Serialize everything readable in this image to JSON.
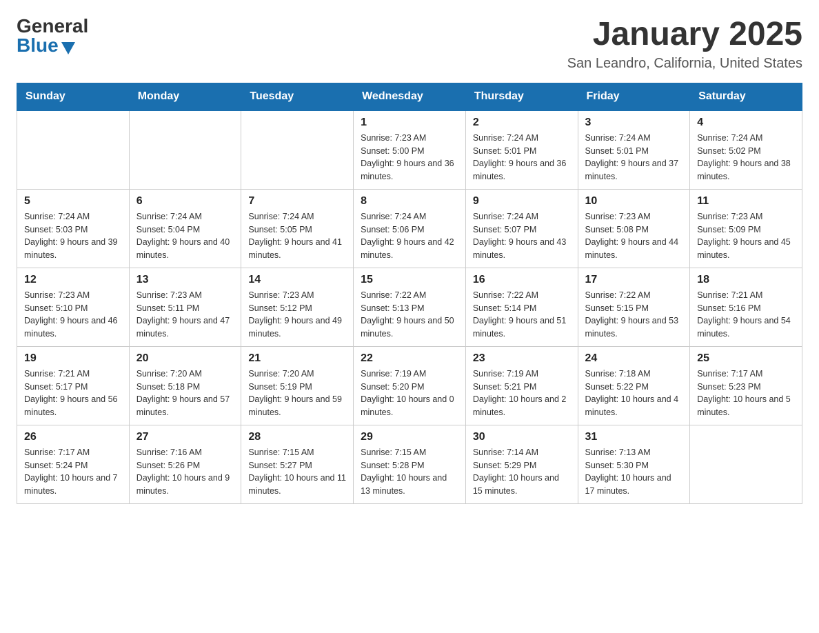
{
  "header": {
    "logo_general": "General",
    "logo_blue": "Blue",
    "month_year": "January 2025",
    "location": "San Leandro, California, United States"
  },
  "weekdays": [
    "Sunday",
    "Monday",
    "Tuesday",
    "Wednesday",
    "Thursday",
    "Friday",
    "Saturday"
  ],
  "weeks": [
    [
      {
        "day": "",
        "sunrise": "",
        "sunset": "",
        "daylight": ""
      },
      {
        "day": "",
        "sunrise": "",
        "sunset": "",
        "daylight": ""
      },
      {
        "day": "",
        "sunrise": "",
        "sunset": "",
        "daylight": ""
      },
      {
        "day": "1",
        "sunrise": "Sunrise: 7:23 AM",
        "sunset": "Sunset: 5:00 PM",
        "daylight": "Daylight: 9 hours and 36 minutes."
      },
      {
        "day": "2",
        "sunrise": "Sunrise: 7:24 AM",
        "sunset": "Sunset: 5:01 PM",
        "daylight": "Daylight: 9 hours and 36 minutes."
      },
      {
        "day": "3",
        "sunrise": "Sunrise: 7:24 AM",
        "sunset": "Sunset: 5:01 PM",
        "daylight": "Daylight: 9 hours and 37 minutes."
      },
      {
        "day": "4",
        "sunrise": "Sunrise: 7:24 AM",
        "sunset": "Sunset: 5:02 PM",
        "daylight": "Daylight: 9 hours and 38 minutes."
      }
    ],
    [
      {
        "day": "5",
        "sunrise": "Sunrise: 7:24 AM",
        "sunset": "Sunset: 5:03 PM",
        "daylight": "Daylight: 9 hours and 39 minutes."
      },
      {
        "day": "6",
        "sunrise": "Sunrise: 7:24 AM",
        "sunset": "Sunset: 5:04 PM",
        "daylight": "Daylight: 9 hours and 40 minutes."
      },
      {
        "day": "7",
        "sunrise": "Sunrise: 7:24 AM",
        "sunset": "Sunset: 5:05 PM",
        "daylight": "Daylight: 9 hours and 41 minutes."
      },
      {
        "day": "8",
        "sunrise": "Sunrise: 7:24 AM",
        "sunset": "Sunset: 5:06 PM",
        "daylight": "Daylight: 9 hours and 42 minutes."
      },
      {
        "day": "9",
        "sunrise": "Sunrise: 7:24 AM",
        "sunset": "Sunset: 5:07 PM",
        "daylight": "Daylight: 9 hours and 43 minutes."
      },
      {
        "day": "10",
        "sunrise": "Sunrise: 7:23 AM",
        "sunset": "Sunset: 5:08 PM",
        "daylight": "Daylight: 9 hours and 44 minutes."
      },
      {
        "day": "11",
        "sunrise": "Sunrise: 7:23 AM",
        "sunset": "Sunset: 5:09 PM",
        "daylight": "Daylight: 9 hours and 45 minutes."
      }
    ],
    [
      {
        "day": "12",
        "sunrise": "Sunrise: 7:23 AM",
        "sunset": "Sunset: 5:10 PM",
        "daylight": "Daylight: 9 hours and 46 minutes."
      },
      {
        "day": "13",
        "sunrise": "Sunrise: 7:23 AM",
        "sunset": "Sunset: 5:11 PM",
        "daylight": "Daylight: 9 hours and 47 minutes."
      },
      {
        "day": "14",
        "sunrise": "Sunrise: 7:23 AM",
        "sunset": "Sunset: 5:12 PM",
        "daylight": "Daylight: 9 hours and 49 minutes."
      },
      {
        "day": "15",
        "sunrise": "Sunrise: 7:22 AM",
        "sunset": "Sunset: 5:13 PM",
        "daylight": "Daylight: 9 hours and 50 minutes."
      },
      {
        "day": "16",
        "sunrise": "Sunrise: 7:22 AM",
        "sunset": "Sunset: 5:14 PM",
        "daylight": "Daylight: 9 hours and 51 minutes."
      },
      {
        "day": "17",
        "sunrise": "Sunrise: 7:22 AM",
        "sunset": "Sunset: 5:15 PM",
        "daylight": "Daylight: 9 hours and 53 minutes."
      },
      {
        "day": "18",
        "sunrise": "Sunrise: 7:21 AM",
        "sunset": "Sunset: 5:16 PM",
        "daylight": "Daylight: 9 hours and 54 minutes."
      }
    ],
    [
      {
        "day": "19",
        "sunrise": "Sunrise: 7:21 AM",
        "sunset": "Sunset: 5:17 PM",
        "daylight": "Daylight: 9 hours and 56 minutes."
      },
      {
        "day": "20",
        "sunrise": "Sunrise: 7:20 AM",
        "sunset": "Sunset: 5:18 PM",
        "daylight": "Daylight: 9 hours and 57 minutes."
      },
      {
        "day": "21",
        "sunrise": "Sunrise: 7:20 AM",
        "sunset": "Sunset: 5:19 PM",
        "daylight": "Daylight: 9 hours and 59 minutes."
      },
      {
        "day": "22",
        "sunrise": "Sunrise: 7:19 AM",
        "sunset": "Sunset: 5:20 PM",
        "daylight": "Daylight: 10 hours and 0 minutes."
      },
      {
        "day": "23",
        "sunrise": "Sunrise: 7:19 AM",
        "sunset": "Sunset: 5:21 PM",
        "daylight": "Daylight: 10 hours and 2 minutes."
      },
      {
        "day": "24",
        "sunrise": "Sunrise: 7:18 AM",
        "sunset": "Sunset: 5:22 PM",
        "daylight": "Daylight: 10 hours and 4 minutes."
      },
      {
        "day": "25",
        "sunrise": "Sunrise: 7:17 AM",
        "sunset": "Sunset: 5:23 PM",
        "daylight": "Daylight: 10 hours and 5 minutes."
      }
    ],
    [
      {
        "day": "26",
        "sunrise": "Sunrise: 7:17 AM",
        "sunset": "Sunset: 5:24 PM",
        "daylight": "Daylight: 10 hours and 7 minutes."
      },
      {
        "day": "27",
        "sunrise": "Sunrise: 7:16 AM",
        "sunset": "Sunset: 5:26 PM",
        "daylight": "Daylight: 10 hours and 9 minutes."
      },
      {
        "day": "28",
        "sunrise": "Sunrise: 7:15 AM",
        "sunset": "Sunset: 5:27 PM",
        "daylight": "Daylight: 10 hours and 11 minutes."
      },
      {
        "day": "29",
        "sunrise": "Sunrise: 7:15 AM",
        "sunset": "Sunset: 5:28 PM",
        "daylight": "Daylight: 10 hours and 13 minutes."
      },
      {
        "day": "30",
        "sunrise": "Sunrise: 7:14 AM",
        "sunset": "Sunset: 5:29 PM",
        "daylight": "Daylight: 10 hours and 15 minutes."
      },
      {
        "day": "31",
        "sunrise": "Sunrise: 7:13 AM",
        "sunset": "Sunset: 5:30 PM",
        "daylight": "Daylight: 10 hours and 17 minutes."
      },
      {
        "day": "",
        "sunrise": "",
        "sunset": "",
        "daylight": ""
      }
    ]
  ]
}
